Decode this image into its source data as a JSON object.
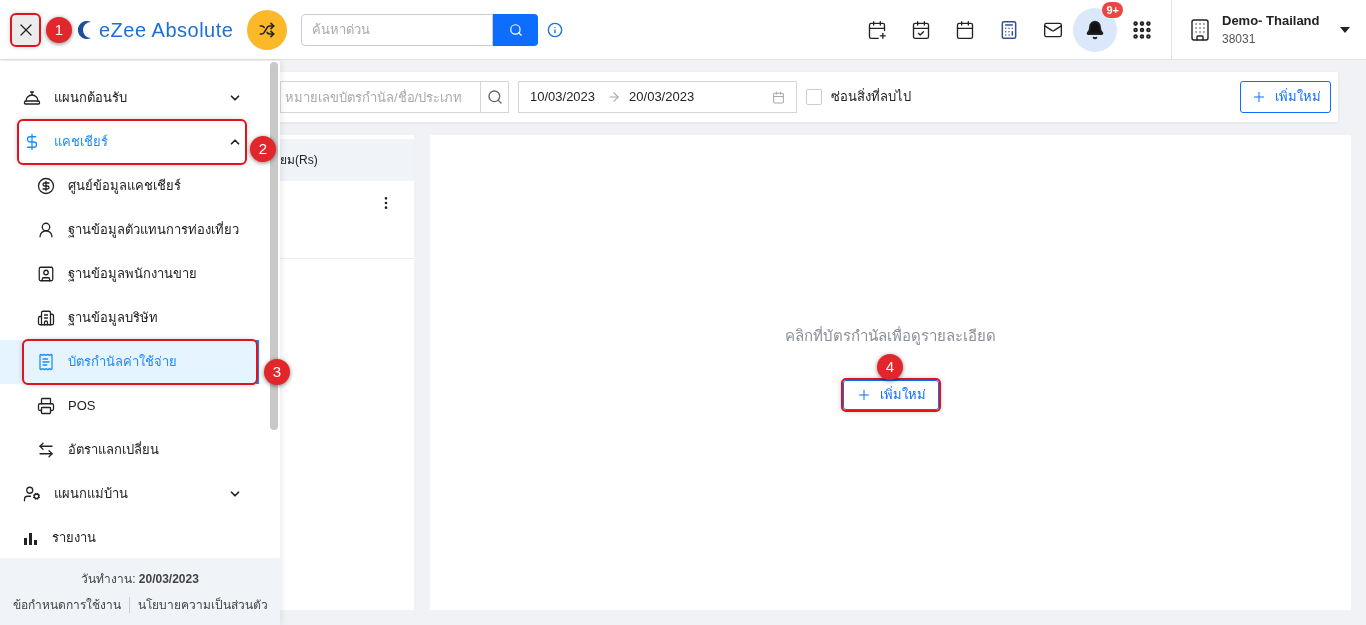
{
  "header": {
    "close_highlighted": true,
    "logo_text": "eZee Absolute",
    "search": {
      "placeholder": "ค้นหาด่วน"
    },
    "notification_badge": "9+",
    "property": {
      "name": "Demo- Thailand",
      "code": "38031"
    }
  },
  "sidebar": {
    "items": [
      {
        "kind": "group",
        "label": "แผนกต้อนรับ",
        "expanded": false,
        "selected": false,
        "highlighted": false
      },
      {
        "kind": "group",
        "label": "แคชเชียร์",
        "expanded": true,
        "selected": true,
        "highlighted": true
      },
      {
        "kind": "sub",
        "label": "ศูนย์ข้อมูลแคชเชียร์",
        "selected": false,
        "highlighted": false
      },
      {
        "kind": "sub",
        "label": "ฐานข้อมูลตัวแทนการท่องเที่ยว",
        "selected": false,
        "highlighted": false
      },
      {
        "kind": "sub",
        "label": "ฐานข้อมูลพนักงานขาย",
        "selected": false,
        "highlighted": false
      },
      {
        "kind": "sub",
        "label": "ฐานข้อมูลบริษัท",
        "selected": false,
        "highlighted": false
      },
      {
        "kind": "sub",
        "label": "บัตรกำนัลค่าใช้จ่าย",
        "selected": true,
        "highlighted": true
      },
      {
        "kind": "sub",
        "label": "POS",
        "selected": false,
        "highlighted": false
      },
      {
        "kind": "sub",
        "label": "อัตราแลกเปลี่ยน",
        "selected": false,
        "highlighted": false
      },
      {
        "kind": "group",
        "label": "แผนกแม่บ้าน",
        "expanded": false,
        "selected": false,
        "highlighted": false
      },
      {
        "kind": "group",
        "label": "รายงาน",
        "selected": false,
        "highlighted": false
      }
    ],
    "footer": {
      "work_date": "วันทำงาน: **20/03/2023**",
      "links": [
        "ข้อกำหนดการใช้งาน",
        "นโยบายความเป็นส่วนตัว"
      ]
    }
  },
  "toolbar": {
    "search": {
      "placeholder": "หมายเลขบัตรกำนัล/ชื่อ/ประเภท"
    },
    "date_from": "10/03/2023",
    "date_to": "20/03/2023",
    "hide_deleted": {
      "label": "ซ่อนสิ่งที่ลบไป",
      "checked": false
    },
    "add_button": "เพิ่มใหม่"
  },
  "list_panel": {
    "column_header": "ยม(Rs)"
  },
  "detail_panel": {
    "message": "คลิกที่บัตรกำนัลเพื่อดูรายละเอียด",
    "add_button": "เพิ่มใหม่",
    "add_highlighted": true
  },
  "callouts": [
    "1",
    "2",
    "3",
    "4"
  ]
}
